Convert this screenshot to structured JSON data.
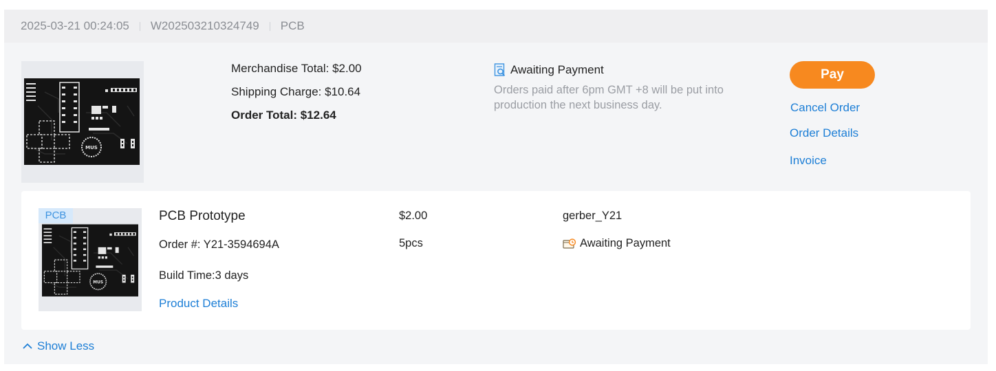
{
  "header": {
    "date": "2025-03-21 00:24:05",
    "order_id": "W202503210324749",
    "category": "PCB"
  },
  "summary": {
    "merchandise": "Merchandise Total: $2.00",
    "shipping": "Shipping Charge: $10.64",
    "order_total": "Order Total: $12.64",
    "status": "Awaiting Payment",
    "status_icon": "document-search-icon",
    "note": "Orders paid after 6pm GMT +8 will be put into production the next business day."
  },
  "actions": {
    "pay": "Pay",
    "cancel": "Cancel Order",
    "details": "Order Details",
    "invoice": "Invoice"
  },
  "item": {
    "tag": "PCB",
    "title": "PCB Prototype",
    "order_no": "Order #:  Y21-3594694A",
    "build_time": "Build Time:3 days",
    "details_link": "Product Details",
    "price": "$2.00",
    "quantity": "5pcs",
    "file": "gerber_Y21",
    "status": "Awaiting Payment",
    "status_icon": "wallet-clock-icon"
  },
  "toggle": {
    "label": "Show Less",
    "icon": "chevron-up-icon"
  },
  "colors": {
    "accent": "#f7891f",
    "link": "#1c7ed6",
    "card_bg": "#f4f5f7",
    "header_bg": "#efeff1"
  }
}
